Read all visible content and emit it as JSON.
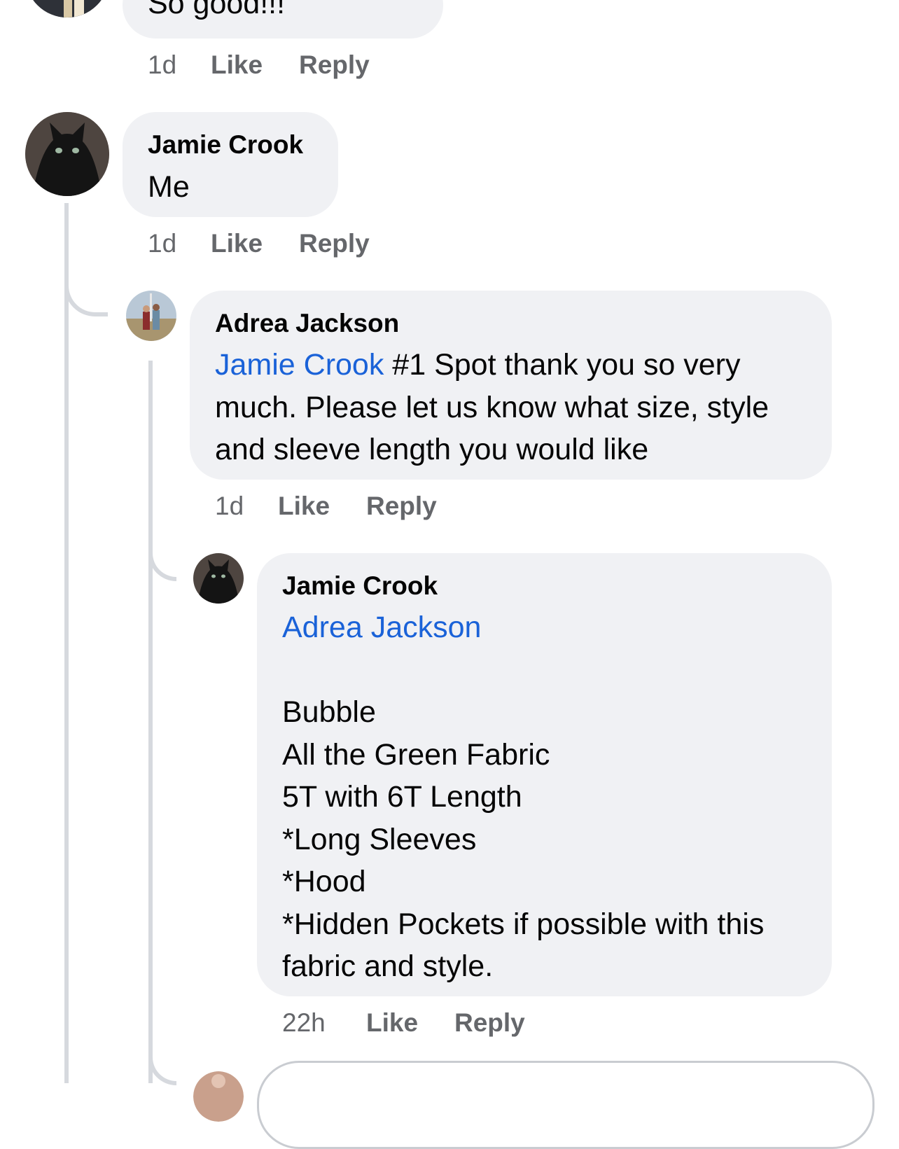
{
  "comments": [
    {
      "text_lines": [
        "So good!!!"
      ],
      "time": "1d",
      "like": "Like",
      "reply": "Reply"
    },
    {
      "author": "Jamie Crook",
      "text_lines": [
        "Me"
      ],
      "time": "1d",
      "like": "Like",
      "reply": "Reply"
    },
    {
      "author": "Adrea Jackson",
      "mention": "Jamie Crook",
      "text_lines": [
        " #1 Spot thank you so very",
        "much. Please let us know what size, style",
        "and sleeve length you would like"
      ],
      "time": "1d",
      "like": "Like",
      "reply": "Reply"
    },
    {
      "author": "Jamie Crook",
      "mention": "Adrea Jackson",
      "text_lines": [
        "",
        "Bubble",
        "All the Green Fabric",
        "5T with 6T Length",
        "*Long Sleeves",
        "*Hood",
        "*Hidden Pockets if possible with this",
        "fabric and style."
      ],
      "time": "22h",
      "like": "Like",
      "reply": "Reply"
    }
  ],
  "colors": {
    "bubble": "#f0f1f4",
    "mention": "#1a62d8",
    "meta": "#65676b",
    "thread_line": "#d6d9de"
  }
}
